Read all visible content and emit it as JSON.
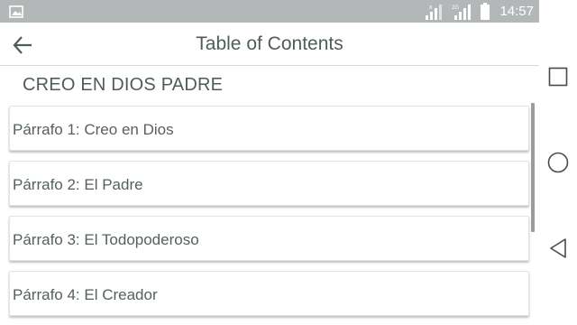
{
  "status_bar": {
    "time": "14:57",
    "network_label": "2G",
    "icons": [
      "image-notification-icon",
      "signal-no-sim-icon",
      "signal-2g-icon",
      "battery-icon"
    ]
  },
  "app_bar": {
    "title": "Table of Contents",
    "back_icon": "arrow-back-icon"
  },
  "section": {
    "heading": "CREO EN DIOS PADRE"
  },
  "items": [
    {
      "label": "Párrafo 1: Creo en Dios"
    },
    {
      "label": "Párrafo 2: El Padre"
    },
    {
      "label": "Párrafo 3: El Todopoderoso"
    },
    {
      "label": "Párrafo 4: El Creador"
    }
  ],
  "nav_bar": {
    "buttons": [
      "recent-apps-icon",
      "home-icon",
      "back-icon"
    ]
  },
  "colors": {
    "status_bar_bg": "#b3b7b8",
    "text": "#4f5b5d",
    "card_border": "#e2e2e2"
  }
}
